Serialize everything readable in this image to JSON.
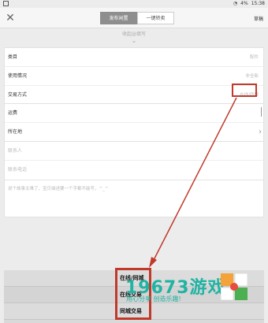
{
  "statusbar": {
    "battery": "4%",
    "time": "15:38"
  },
  "header": {
    "close_icon": "close-icon",
    "tabs": [
      {
        "label": "发布闲置",
        "active": true
      },
      {
        "label": "一键转卖",
        "active": false
      }
    ],
    "draft_label": "草稿"
  },
  "collapse_hint": "收起@填写",
  "form": {
    "section1": [
      {
        "label": "类目",
        "value": "配件"
      },
      {
        "label": "使用情况",
        "value": "非全新"
      },
      {
        "label": "交易方式",
        "value": "在线/同城"
      }
    ],
    "section2": [
      {
        "label": "运费"
      },
      {
        "label": "所在地"
      }
    ],
    "section3": [
      {
        "placeholder": "联系人"
      },
      {
        "placeholder": "联系电话"
      }
    ],
    "description_placeholder": "说个故事太难了，宝贝描述要一个字都不能写，^_^"
  },
  "sheet": {
    "options": [
      "在线/同城",
      "在线交易",
      "同城交易"
    ]
  },
  "watermark": {
    "title": "19673游戏",
    "subtitle": "用心分享  创造乐趣!"
  },
  "colors": {
    "highlight": "#c0392b",
    "accent": "#21b3a3"
  }
}
